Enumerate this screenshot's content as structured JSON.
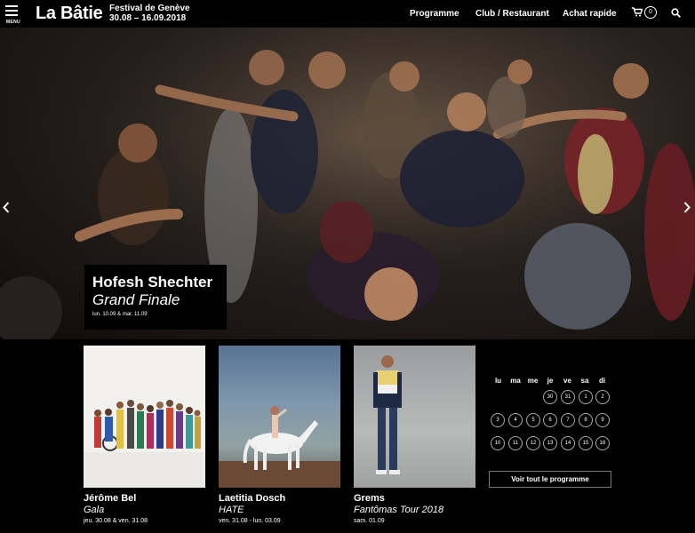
{
  "header": {
    "menu_label": "MENU",
    "logo": "La Bâtie",
    "subtitle_line1": "Festival de Genève",
    "subtitle_line2": "30.08 – 16.09.2018",
    "nav": [
      "Programme",
      "Club / Restaurant",
      "Achat rapide"
    ],
    "cart_count": "0"
  },
  "hero": {
    "title": "Hofesh Shechter",
    "show": "Grand Finale",
    "dates": "lun. 10.09 & mar. 11.09"
  },
  "cards": [
    {
      "name": "Jérôme Bel",
      "show": "Gala",
      "dates": "jeu. 30.08 & ven. 31.08"
    },
    {
      "name": "Laetitia Dosch",
      "show": "HATE",
      "dates": "ven. 31.08 - lun. 03.09"
    },
    {
      "name": "Grems",
      "show": "Fantômas Tour 2018",
      "dates": "sam. 01.09"
    }
  ],
  "calendar": {
    "weekdays": [
      "lu",
      "ma",
      "me",
      "je",
      "ve",
      "sa",
      "di"
    ],
    "row1": [
      "30",
      "31",
      "1",
      "2"
    ],
    "row2": [
      "3",
      "4",
      "5",
      "6",
      "7",
      "8",
      "9"
    ],
    "row3": [
      "10",
      "11",
      "12",
      "13",
      "14",
      "15",
      "16"
    ],
    "button": "Voir tout le programme"
  }
}
